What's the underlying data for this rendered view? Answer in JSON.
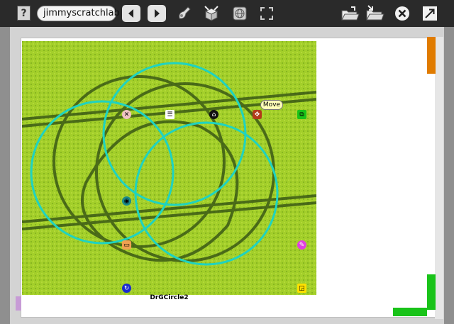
{
  "toolbar": {
    "help_label": "?",
    "project_name": "jimmyscratchlab",
    "icons": [
      "help-icon",
      "back-arrow-icon",
      "forward-arrow-icon",
      "paint-icon",
      "open-box-icon",
      "globe-icon",
      "fullscreen-icon",
      "open-folder-icon",
      "save-folder-icon",
      "close-icon",
      "expand-icon"
    ]
  },
  "canvas": {
    "morph_name": "DrGCircle2",
    "balloon_text": "Move",
    "colors": {
      "circle": "#1fd3c0",
      "field": "#a6d22b",
      "scroll": "#e07b00",
      "green_handle": "#19c319"
    }
  }
}
